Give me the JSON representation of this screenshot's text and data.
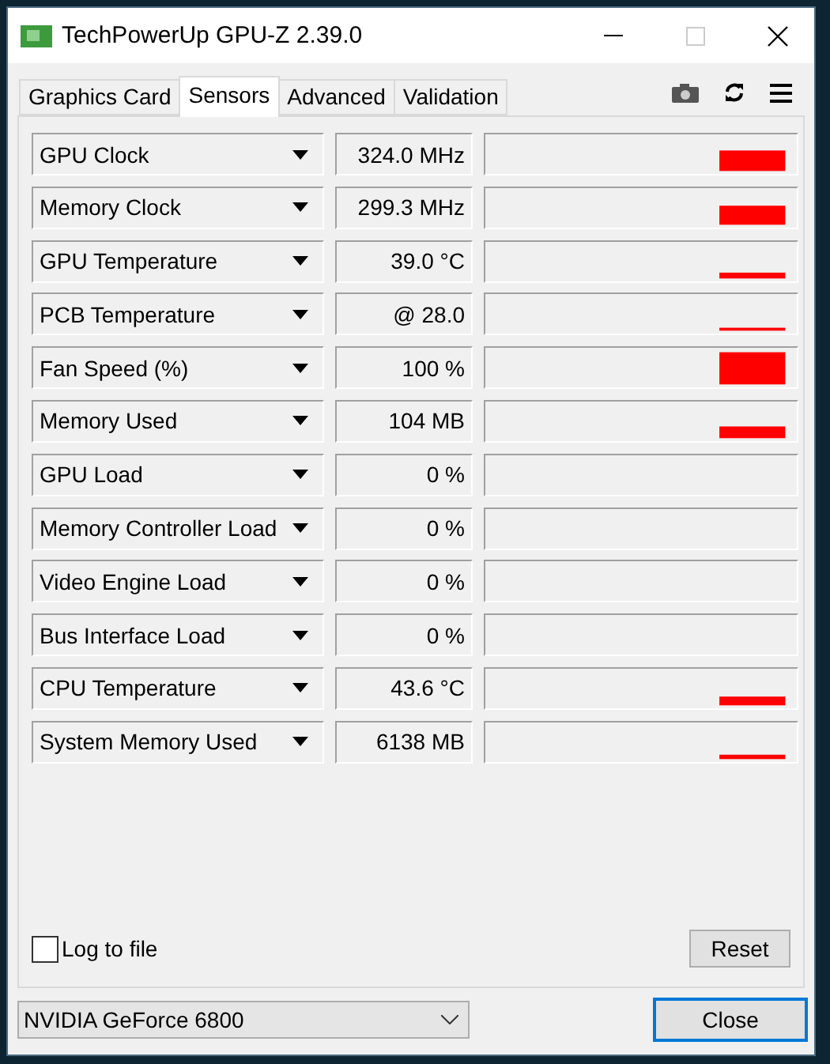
{
  "window": {
    "title": "TechPowerUp GPU-Z 2.39.0"
  },
  "tabs": [
    {
      "label": "Graphics Card",
      "selected": false
    },
    {
      "label": "Sensors",
      "selected": true
    },
    {
      "label": "Advanced",
      "selected": false
    },
    {
      "label": "Validation",
      "selected": false
    }
  ],
  "sensors": [
    {
      "name": "GPU Clock",
      "reading": "324.0 MHz"
    },
    {
      "name": "Memory Clock",
      "reading": "299.3 MHz"
    },
    {
      "name": "GPU Temperature",
      "reading": "39.0 °C"
    },
    {
      "name": "PCB Temperature",
      "reading": "@ 28.0"
    },
    {
      "name": "Fan Speed (%)",
      "reading": "100 %"
    },
    {
      "name": "Memory Used",
      "reading": "104 MB"
    },
    {
      "name": "GPU Load",
      "reading": "0 %"
    },
    {
      "name": "Memory Controller Load",
      "reading": "0 %"
    },
    {
      "name": "Video Engine Load",
      "reading": "0 %"
    },
    {
      "name": "Bus Interface Load",
      "reading": "0 %"
    },
    {
      "name": "CPU Temperature",
      "reading": "43.6 °C"
    },
    {
      "name": "System Memory Used",
      "reading": "6138 MB"
    }
  ],
  "log_to_file": {
    "label": "Log to file",
    "checked": false
  },
  "reset_button": "Reset",
  "gpu_select": {
    "value": "NVIDIA GeForce 6800"
  },
  "close_button": "Close"
}
